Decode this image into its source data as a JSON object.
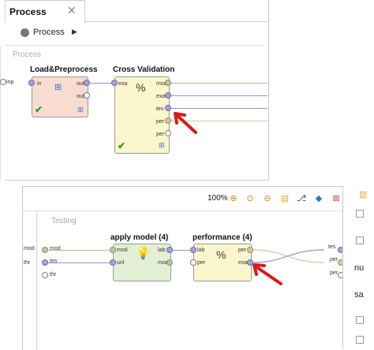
{
  "top": {
    "tab_label": "Process",
    "tab_close": "✕",
    "breadcrumb": "Process",
    "breadcrumb_arrow": "▶",
    "area_title": "Process",
    "inp_label": "inp",
    "load": {
      "title": "Load&Preprocess",
      "in_label": "in",
      "out1_label": "out",
      "out2_label": "out"
    },
    "cv": {
      "title": "Cross Validation",
      "exa_in_label": "exa",
      "out_labels": [
        "mod",
        "exa",
        "tes",
        "per",
        "per"
      ]
    }
  },
  "bottom": {
    "zoom": "100%",
    "area_title": "Testing",
    "left_ports": [
      "mod",
      "tes",
      "thr"
    ],
    "left_outer_labels": [
      "mod",
      "thr"
    ],
    "apply": {
      "title": "apply model (4)",
      "in_labels": [
        "mod",
        "unl"
      ],
      "out_labels": [
        "lab",
        "mod"
      ]
    },
    "perf": {
      "title": "performance (4)",
      "in_labels": [
        "lab",
        "per"
      ],
      "out_labels": [
        "per",
        "exa"
      ]
    },
    "right_ports": [
      "tes",
      "per",
      "per"
    ],
    "side_labels": [
      "nu",
      "sa"
    ]
  },
  "colors": {
    "annotation_arrow": "#d81b1b",
    "load_fill": "#f8dcd0",
    "cv_fill": "#fbf6cc",
    "apply_fill": "#e3efd3",
    "perf_fill": "#fbf6cc",
    "line_purple": "#9a94d0",
    "line_green": "#a6c590",
    "line_tan": "#d8c8a4"
  }
}
